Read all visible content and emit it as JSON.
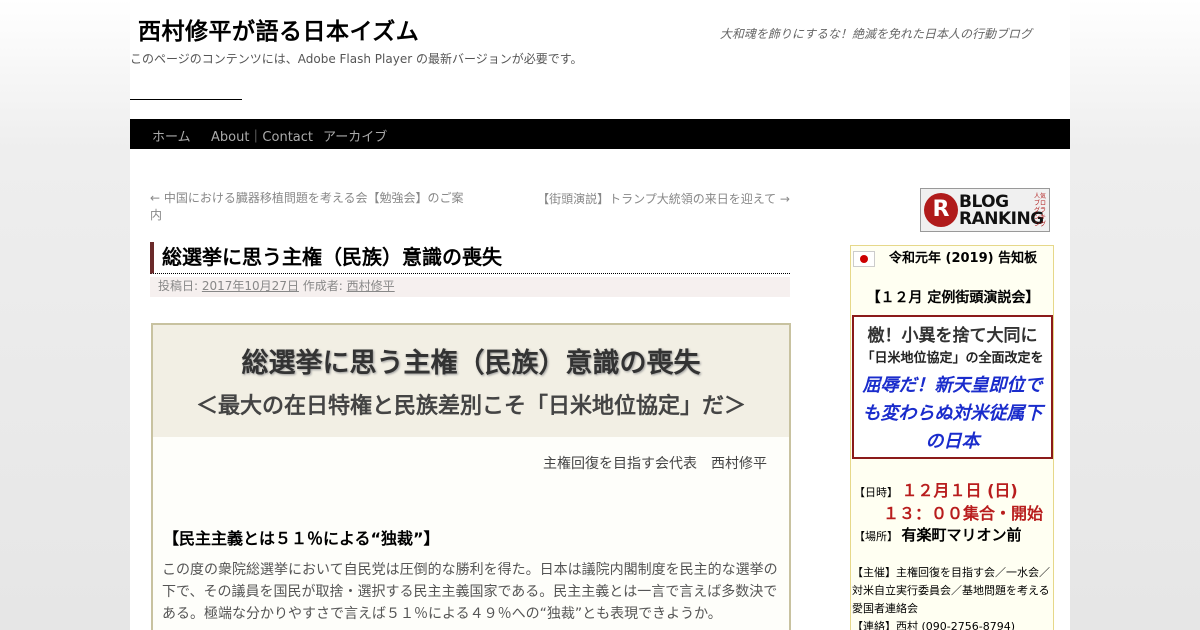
{
  "site": {
    "title": "西村修平が語る日本イズム",
    "description": "大和魂を飾りにするな！絶滅を免れた日本人の行動ブログ",
    "flash_note": "このページのコンテンツには、Adobe Flash Player の最新バージョンが必要です。"
  },
  "menu": {
    "items": [
      "ホーム",
      "About｜Contact",
      "アーカイブ"
    ]
  },
  "post_nav": {
    "prev": "← 中国における臓器移植問題を考える会【勉強会】のご案内",
    "next": "【街頭演説】トランプ大統領の来日を迎えて →"
  },
  "entry": {
    "title": "総選挙に思う主権（民族）意識の喪失",
    "meta_posted_label": "投稿日:",
    "meta_date": "2017年10月27日",
    "meta_author_label": "作成者:",
    "meta_author": "西村修平"
  },
  "post": {
    "head_title": "総選挙に思う主権（民族）意識の喪失",
    "head_sub": "＜最大の在日特権と民族差別こそ「日米地位協定」だ＞",
    "author_line": "主権回復を目指す会代表　西村修平",
    "section_heading": "【民主主義とは５１％による“独裁”】",
    "body": "この度の衆院総選挙において自民党は圧倒的な勝利を得た。日本は議院内閣制度を民主的な選挙の下で、その議員を国民が取捨・選択する民主主義国家である。民主主義とは一言で言えば多数決である。極端な分かりやすさで言えば５１％による４９％への“独裁”とも表現できようか。"
  },
  "sidebar": {
    "blog_ranking": {
      "mark": "R",
      "text_l1": "BLOG",
      "text_l2": "RANKING",
      "mini": "人気ブログランキング"
    },
    "notice": {
      "header": "令和元年 (2019) 告知板",
      "title": "【１２月 定例街頭演説会】",
      "banner_l1": "檄！小異を捨て大同に",
      "banner_l2": "「日米地位協定」の全面改定を",
      "banner_l3": "屈辱だ！新天皇即位でも変わらぬ対米従属下の日本",
      "date_label": "【日時】",
      "date_value": "１２月１日 (日)",
      "time_value": "１３：００集合・開始",
      "place_label": "【場所】",
      "place_value": "有楽町マリオン前",
      "org": "【主催】主権回復を目指す会／一水会／対米自立実行委員会／基地問題を考える愛国者連絡会",
      "contact": "【連絡】西村 (090-2756-8794)"
    }
  }
}
